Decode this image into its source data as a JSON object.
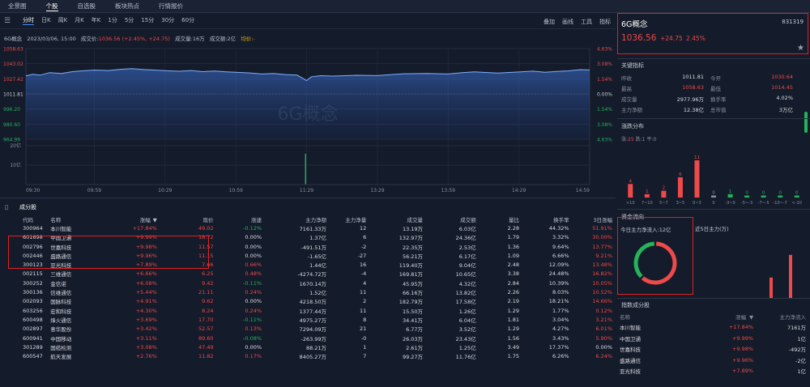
{
  "top_nav": {
    "items": [
      "全景图",
      "个股",
      "自选股",
      "板块热点",
      "行情报价"
    ],
    "active": 1
  },
  "toolbar": {
    "timeframes": [
      "分时",
      "日K",
      "周K",
      "月K",
      "年K",
      "1分",
      "5分",
      "15分",
      "30分",
      "60分"
    ],
    "active": 0,
    "tools": [
      "叠加",
      "画线",
      "工具",
      "指标"
    ]
  },
  "info_line": {
    "name": "6G概念",
    "datetime": "2023/03/06, 15:00",
    "price_label": "成交价:",
    "price_value": "1036.56 (+2.45%, +24.75)",
    "vol_label": "成交量:",
    "vol_value": "16万",
    "amt_label": "成交额:",
    "amt_value": "2亿",
    "avg_label": "均价:",
    "avg_value": "-"
  },
  "chart_data": {
    "type": "line",
    "watermark": "6G概念",
    "y_left_ticks": [
      "1058.63",
      "1043.02",
      "1027.42",
      "1011.81",
      "996.20",
      "980.60",
      "964.99"
    ],
    "y_right_ticks": [
      "4.63%",
      "3.08%",
      "1.54%",
      "0.00%",
      "1.54%",
      "3.08%",
      "4.63%"
    ],
    "ylim": [
      964.99,
      1058.63
    ],
    "prev_close": 1011.81,
    "volume_ticks": [
      "20亿",
      "10亿"
    ],
    "x_ticks": [
      "09:30",
      "09:59",
      "10:29",
      "10:59",
      "11:29",
      "13:29",
      "13:59",
      "14:29",
      "14:59"
    ],
    "series": [
      {
        "x": [
          "09:30",
          "09:33",
          "09:36",
          "09:40",
          "09:45",
          "09:50",
          "09:55",
          "09:59",
          "10:05",
          "10:10",
          "10:15",
          "10:20",
          "10:25",
          "10:29",
          "10:35",
          "10:40",
          "10:45",
          "10:50",
          "10:55",
          "10:59",
          "11:05",
          "11:10",
          "11:15",
          "11:20",
          "11:25",
          "11:29",
          "13:01",
          "13:05",
          "13:10",
          "13:20",
          "13:29",
          "13:40",
          "13:50",
          "13:59",
          "14:05",
          "14:10",
          "14:20",
          "14:29",
          "14:35",
          "14:40",
          "14:45",
          "14:50",
          "14:55",
          "14:59"
        ],
        "values": [
          1030.5,
          1032.1,
          1031.2,
          1033.8,
          1033.0,
          1034.9,
          1035.8,
          1036.4,
          1036.0,
          1037.2,
          1038.0,
          1037.0,
          1036.4,
          1035.9,
          1035.2,
          1036.0,
          1034.8,
          1035.5,
          1034.6,
          1034.1,
          1033.5,
          1032.4,
          1032.9,
          1031.8,
          1031.2,
          1025.6,
          1029.5,
          1030.6,
          1030.2,
          1031.0,
          1030.7,
          1032.6,
          1033.0,
          1032.4,
          1033.8,
          1034.6,
          1033.4,
          1034.5,
          1035.3,
          1034.2,
          1035.0,
          1035.6,
          1036.9,
          1036.56
        ]
      }
    ],
    "volume_spike": {
      "x": "11:29",
      "value": 22
    }
  },
  "quote_box": {
    "name": "6G概念",
    "code": "831319",
    "price": "1036.56",
    "change": "+24.75",
    "change_pct": "2.45%"
  },
  "key_indicators": {
    "title": "关键指标",
    "rows": [
      [
        {
          "label": "昨收",
          "value": "1011.81",
          "color": "wh"
        },
        {
          "label": "今开",
          "value": "1030.64",
          "color": "up"
        }
      ],
      [
        {
          "label": "最高",
          "value": "1058.63",
          "color": "up"
        },
        {
          "label": "最低",
          "value": "1014.45",
          "color": "up"
        }
      ],
      [
        {
          "label": "成交量",
          "value": "2977.96万",
          "color": "wh"
        },
        {
          "label": "换手率",
          "value": "4.02%",
          "color": "wh"
        }
      ],
      [
        {
          "label": "主力净额",
          "value": "12.38亿",
          "color": "wh"
        },
        {
          "label": "总市值",
          "value": "3万亿",
          "color": "wh"
        }
      ]
    ]
  },
  "distribution": {
    "title": "涨跌分布",
    "legend": {
      "up_label": "涨:",
      "up_value": "25",
      "down_label": "跌:",
      "down_value": "1",
      "flat_label": "平:",
      "flat_value": "0"
    },
    "chart_data": {
      "type": "bar",
      "categories": [
        ">10",
        "7~10",
        "5~7",
        "3~5",
        "0~3",
        "0",
        "-3~0",
        "-5~-3",
        "-7~-5",
        "-10~-7",
        "<-10"
      ],
      "values": [
        4,
        1,
        2,
        6,
        11,
        0,
        1,
        0,
        0,
        0,
        0
      ],
      "colors": [
        "#ef4a4a",
        "#ef4a4a",
        "#ef4a4a",
        "#ef4a4a",
        "#ef4a4a",
        "#8a90a0",
        "#24b35a",
        "#24b35a",
        "#24b35a",
        "#24b35a",
        "#24b35a"
      ]
    }
  },
  "fund_flow": {
    "title": "资金流向",
    "today_label": "今日主力净流入:",
    "today_value": "12亿",
    "five_day_label": "近5日主力(万)",
    "donut": {
      "inflow_fraction": 0.62,
      "outflow_fraction": 0.38
    },
    "five_day_bars": [
      0,
      0,
      0,
      0.45,
      0.95
    ]
  },
  "index_constituents": {
    "title": "指数成分股",
    "headers": [
      "名称",
      "涨幅",
      "主力净流入"
    ],
    "sort_arrow": "▼",
    "rows": [
      {
        "name": "本川智能",
        "change": "+17.84%",
        "flow": "7161万"
      },
      {
        "name": "中国卫通",
        "change": "+9.99%",
        "flow": "1亿"
      },
      {
        "name": "世嘉科技",
        "change": "+9.98%",
        "flow": "-492万"
      },
      {
        "name": "盛路通信",
        "change": "+9.96%",
        "flow": "-2亿"
      },
      {
        "name": "亚光科技",
        "change": "+7.89%",
        "flow": "1亿"
      }
    ]
  },
  "constituents": {
    "tab_title": "成分股",
    "headers": [
      "代码",
      "名称",
      "涨幅",
      "现价",
      "涨速",
      "主力净额",
      "主力净量",
      "成交量",
      "成交额",
      "量比",
      "换手率",
      "3日涨幅"
    ],
    "sort_arrow": "▼",
    "rows": [
      [
        "300964",
        "本川智能",
        "+17.84%",
        "49.02",
        "-0.12%",
        "7161.33万",
        "12",
        "13.19万",
        "6.03亿",
        "2.28",
        "44.32%",
        "51.91%"
      ],
      [
        "601698",
        "中国卫通",
        "+9.99%",
        "18.72",
        "0.00%",
        "1.37亿",
        "6",
        "132.97万",
        "24.36亿",
        "1.79",
        "3.32%",
        "30.00%"
      ],
      [
        "002796",
        "世嘉科技",
        "+9.98%",
        "11.57",
        "0.00%",
        "-491.51万",
        "-2",
        "22.35万",
        "2.53亿",
        "1.36",
        "9.64%",
        "13.77%"
      ],
      [
        "002446",
        "盛路通信",
        "+9.96%",
        "11.15",
        "0.00%",
        "-1.65亿",
        "-27",
        "56.21万",
        "6.17亿",
        "1.09",
        "6.66%",
        "9.21%"
      ],
      [
        "300123",
        "亚光科技",
        "+7.89%",
        "7.66",
        "0.66%",
        "1.44亿",
        "16",
        "119.40万",
        "9.04亿",
        "2.48",
        "12.09%",
        "13.48%"
      ],
      [
        "002115",
        "三维通信",
        "+6.66%",
        "6.25",
        "0.48%",
        "-4274.72万",
        "-4",
        "169.81万",
        "10.65亿",
        "3.38",
        "24.48%",
        "16.82%"
      ],
      [
        "300252",
        "金信诺",
        "+6.08%",
        "9.42",
        "-0.11%",
        "1670.14万",
        "4",
        "45.95万",
        "4.32亿",
        "2.84",
        "10.39%",
        "10.05%"
      ],
      [
        "300136",
        "信维通信",
        "+5.44%",
        "21.11",
        "0.24%",
        "1.52亿",
        "11",
        "66.16万",
        "13.82亿",
        "2.26",
        "8.03%",
        "10.52%"
      ],
      [
        "002093",
        "国脉科技",
        "+4.91%",
        "9.62",
        "0.00%",
        "4218.50万",
        "2",
        "182.79万",
        "17.58亿",
        "2.19",
        "18.21%",
        "14.66%"
      ],
      [
        "603256",
        "宏和科技",
        "+4.30%",
        "8.24",
        "0.24%",
        "1377.44万",
        "11",
        "15.50万",
        "1.26亿",
        "1.29",
        "1.77%",
        "0.12%"
      ],
      [
        "600498",
        "烽火通信",
        "+3.69%",
        "17.70",
        "-0.11%",
        "4975.27万",
        "8",
        "34.41万",
        "6.04亿",
        "1.81",
        "3.04%",
        "3.21%"
      ],
      [
        "002897",
        "意华股份",
        "+3.42%",
        "52.57",
        "0.13%",
        "7294.09万",
        "21",
        "6.77万",
        "3.52亿",
        "1.29",
        "4.27%",
        "6.01%"
      ],
      [
        "600941",
        "中国移动",
        "+3.11%",
        "89.60",
        "-0.08%",
        "-263.99万",
        "-0",
        "26.03万",
        "23.43亿",
        "1.56",
        "3.43%",
        "5.90%"
      ],
      [
        "301289",
        "国缆检测",
        "+3.08%",
        "47.49",
        "0.00%",
        "88.21万",
        "1",
        "2.61万",
        "1.25亿",
        "3.49",
        "17.37%",
        "0.00%"
      ],
      [
        "600547",
        "航天发展",
        "+2.76%",
        "11.82",
        "0.17%",
        "8405.27万",
        "7",
        "99.27万",
        "11.76亿",
        "1.75",
        "6.26%",
        "6.24%"
      ]
    ]
  }
}
